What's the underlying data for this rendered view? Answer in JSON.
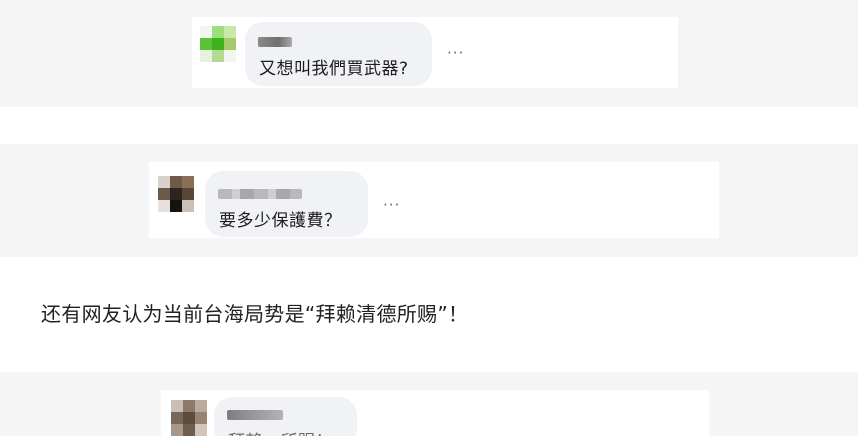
{
  "article": {
    "paragraph": "还有网友认为当前台海局势是“拜赖清德所赐”！"
  },
  "comments": [
    {
      "text": "又想叫我們買武器?",
      "more_label": "···",
      "name_blurred": true
    },
    {
      "text": "要多少保護費？",
      "more_label": "···",
      "name_blurred": true
    },
    {
      "text": "拜賴…所賜！",
      "name_blurred": true
    }
  ],
  "icons": [
    "avatar-icon",
    "more-options-icon"
  ]
}
